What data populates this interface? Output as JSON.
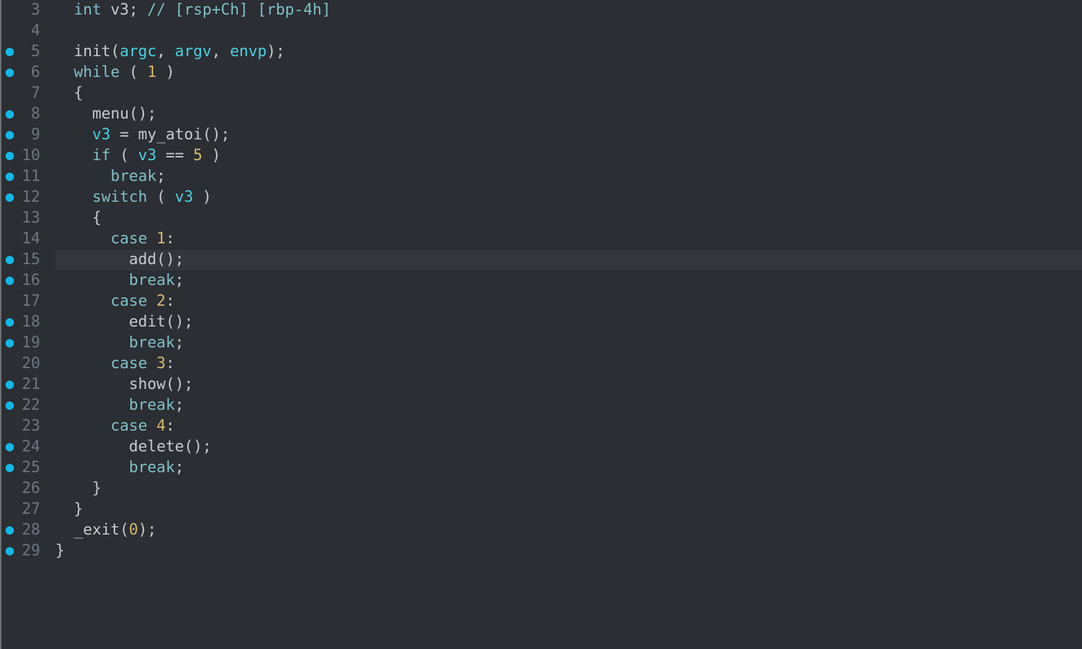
{
  "lines": [
    {
      "num": 3,
      "bp": false,
      "hl": false,
      "indent": 1,
      "tokens": [
        {
          "t": "int ",
          "c": "tk-kw"
        },
        {
          "t": "v3",
          "c": "tk-var"
        },
        {
          "t": "; ",
          "c": "tk-punc"
        },
        {
          "t": "// [rsp+Ch] [rbp-4h]",
          "c": "tk-cmt"
        }
      ]
    },
    {
      "num": 4,
      "bp": false,
      "hl": false,
      "indent": 0,
      "tokens": [
        {
          "t": "",
          "c": ""
        }
      ]
    },
    {
      "num": 5,
      "bp": true,
      "hl": false,
      "indent": 1,
      "tokens": [
        {
          "t": "init",
          "c": "tk-fn"
        },
        {
          "t": "(",
          "c": "tk-punc"
        },
        {
          "t": "argc",
          "c": "tk-arg"
        },
        {
          "t": ", ",
          "c": "tk-punc"
        },
        {
          "t": "argv",
          "c": "tk-arg"
        },
        {
          "t": ", ",
          "c": "tk-punc"
        },
        {
          "t": "envp",
          "c": "tk-arg"
        },
        {
          "t": ");",
          "c": "tk-punc"
        }
      ]
    },
    {
      "num": 6,
      "bp": true,
      "hl": false,
      "indent": 1,
      "tokens": [
        {
          "t": "while",
          "c": "tk-kw"
        },
        {
          "t": " ( ",
          "c": "tk-punc"
        },
        {
          "t": "1",
          "c": "tk-num"
        },
        {
          "t": " )",
          "c": "tk-punc"
        }
      ]
    },
    {
      "num": 7,
      "bp": false,
      "hl": false,
      "indent": 1,
      "tokens": [
        {
          "t": "{",
          "c": "tk-punc"
        }
      ]
    },
    {
      "num": 8,
      "bp": true,
      "hl": false,
      "indent": 2,
      "tokens": [
        {
          "t": "menu",
          "c": "tk-fn"
        },
        {
          "t": "();",
          "c": "tk-punc"
        }
      ]
    },
    {
      "num": 9,
      "bp": true,
      "hl": false,
      "indent": 2,
      "tokens": [
        {
          "t": "v3",
          "c": "tk-arg"
        },
        {
          "t": " = ",
          "c": "tk-op"
        },
        {
          "t": "my_atoi",
          "c": "tk-fn"
        },
        {
          "t": "();",
          "c": "tk-punc"
        }
      ]
    },
    {
      "num": 10,
      "bp": true,
      "hl": false,
      "indent": 2,
      "tokens": [
        {
          "t": "if",
          "c": "tk-kw"
        },
        {
          "t": " ( ",
          "c": "tk-punc"
        },
        {
          "t": "v3",
          "c": "tk-arg"
        },
        {
          "t": " == ",
          "c": "tk-op"
        },
        {
          "t": "5",
          "c": "tk-num"
        },
        {
          "t": " )",
          "c": "tk-punc"
        }
      ]
    },
    {
      "num": 11,
      "bp": true,
      "hl": false,
      "indent": 3,
      "tokens": [
        {
          "t": "break",
          "c": "tk-kw"
        },
        {
          "t": ";",
          "c": "tk-punc"
        }
      ]
    },
    {
      "num": 12,
      "bp": true,
      "hl": false,
      "indent": 2,
      "tokens": [
        {
          "t": "switch",
          "c": "tk-kw"
        },
        {
          "t": " ( ",
          "c": "tk-punc"
        },
        {
          "t": "v3",
          "c": "tk-arg"
        },
        {
          "t": " )",
          "c": "tk-punc"
        }
      ]
    },
    {
      "num": 13,
      "bp": false,
      "hl": false,
      "indent": 2,
      "tokens": [
        {
          "t": "{",
          "c": "tk-punc"
        }
      ]
    },
    {
      "num": 14,
      "bp": false,
      "hl": false,
      "indent": 3,
      "tokens": [
        {
          "t": "case",
          "c": "tk-kw"
        },
        {
          "t": " ",
          "c": ""
        },
        {
          "t": "1",
          "c": "tk-num"
        },
        {
          "t": ":",
          "c": "tk-punc"
        }
      ]
    },
    {
      "num": 15,
      "bp": true,
      "hl": true,
      "indent": 4,
      "tokens": [
        {
          "t": "add",
          "c": "tk-fn"
        },
        {
          "t": "();",
          "c": "tk-punc"
        }
      ]
    },
    {
      "num": 16,
      "bp": true,
      "hl": false,
      "indent": 4,
      "tokens": [
        {
          "t": "break",
          "c": "tk-kw"
        },
        {
          "t": ";",
          "c": "tk-punc"
        }
      ]
    },
    {
      "num": 17,
      "bp": false,
      "hl": false,
      "indent": 3,
      "tokens": [
        {
          "t": "case",
          "c": "tk-kw"
        },
        {
          "t": " ",
          "c": ""
        },
        {
          "t": "2",
          "c": "tk-num"
        },
        {
          "t": ":",
          "c": "tk-punc"
        }
      ]
    },
    {
      "num": 18,
      "bp": true,
      "hl": false,
      "indent": 4,
      "tokens": [
        {
          "t": "edit",
          "c": "tk-fn"
        },
        {
          "t": "();",
          "c": "tk-punc"
        }
      ]
    },
    {
      "num": 19,
      "bp": true,
      "hl": false,
      "indent": 4,
      "tokens": [
        {
          "t": "break",
          "c": "tk-kw"
        },
        {
          "t": ";",
          "c": "tk-punc"
        }
      ]
    },
    {
      "num": 20,
      "bp": false,
      "hl": false,
      "indent": 3,
      "tokens": [
        {
          "t": "case",
          "c": "tk-kw"
        },
        {
          "t": " ",
          "c": ""
        },
        {
          "t": "3",
          "c": "tk-num"
        },
        {
          "t": ":",
          "c": "tk-punc"
        }
      ]
    },
    {
      "num": 21,
      "bp": true,
      "hl": false,
      "indent": 4,
      "tokens": [
        {
          "t": "show",
          "c": "tk-fn"
        },
        {
          "t": "();",
          "c": "tk-punc"
        }
      ]
    },
    {
      "num": 22,
      "bp": true,
      "hl": false,
      "indent": 4,
      "tokens": [
        {
          "t": "break",
          "c": "tk-kw"
        },
        {
          "t": ";",
          "c": "tk-punc"
        }
      ]
    },
    {
      "num": 23,
      "bp": false,
      "hl": false,
      "indent": 3,
      "tokens": [
        {
          "t": "case",
          "c": "tk-kw"
        },
        {
          "t": " ",
          "c": ""
        },
        {
          "t": "4",
          "c": "tk-num"
        },
        {
          "t": ":",
          "c": "tk-punc"
        }
      ]
    },
    {
      "num": 24,
      "bp": true,
      "hl": false,
      "indent": 4,
      "tokens": [
        {
          "t": "delete",
          "c": "tk-fn"
        },
        {
          "t": "();",
          "c": "tk-punc"
        }
      ]
    },
    {
      "num": 25,
      "bp": true,
      "hl": false,
      "indent": 4,
      "tokens": [
        {
          "t": "break",
          "c": "tk-kw"
        },
        {
          "t": ";",
          "c": "tk-punc"
        }
      ]
    },
    {
      "num": 26,
      "bp": false,
      "hl": false,
      "indent": 2,
      "tokens": [
        {
          "t": "}",
          "c": "tk-punc"
        }
      ]
    },
    {
      "num": 27,
      "bp": false,
      "hl": false,
      "indent": 1,
      "tokens": [
        {
          "t": "}",
          "c": "tk-punc"
        }
      ]
    },
    {
      "num": 28,
      "bp": true,
      "hl": false,
      "indent": 1,
      "tokens": [
        {
          "t": "_exit",
          "c": "tk-fn"
        },
        {
          "t": "(",
          "c": "tk-punc"
        },
        {
          "t": "0",
          "c": "tk-num"
        },
        {
          "t": ");",
          "c": "tk-punc"
        }
      ]
    },
    {
      "num": 29,
      "bp": true,
      "hl": false,
      "indent": 0,
      "tokens": [
        {
          "t": "}",
          "c": "tk-punc"
        }
      ]
    }
  ]
}
